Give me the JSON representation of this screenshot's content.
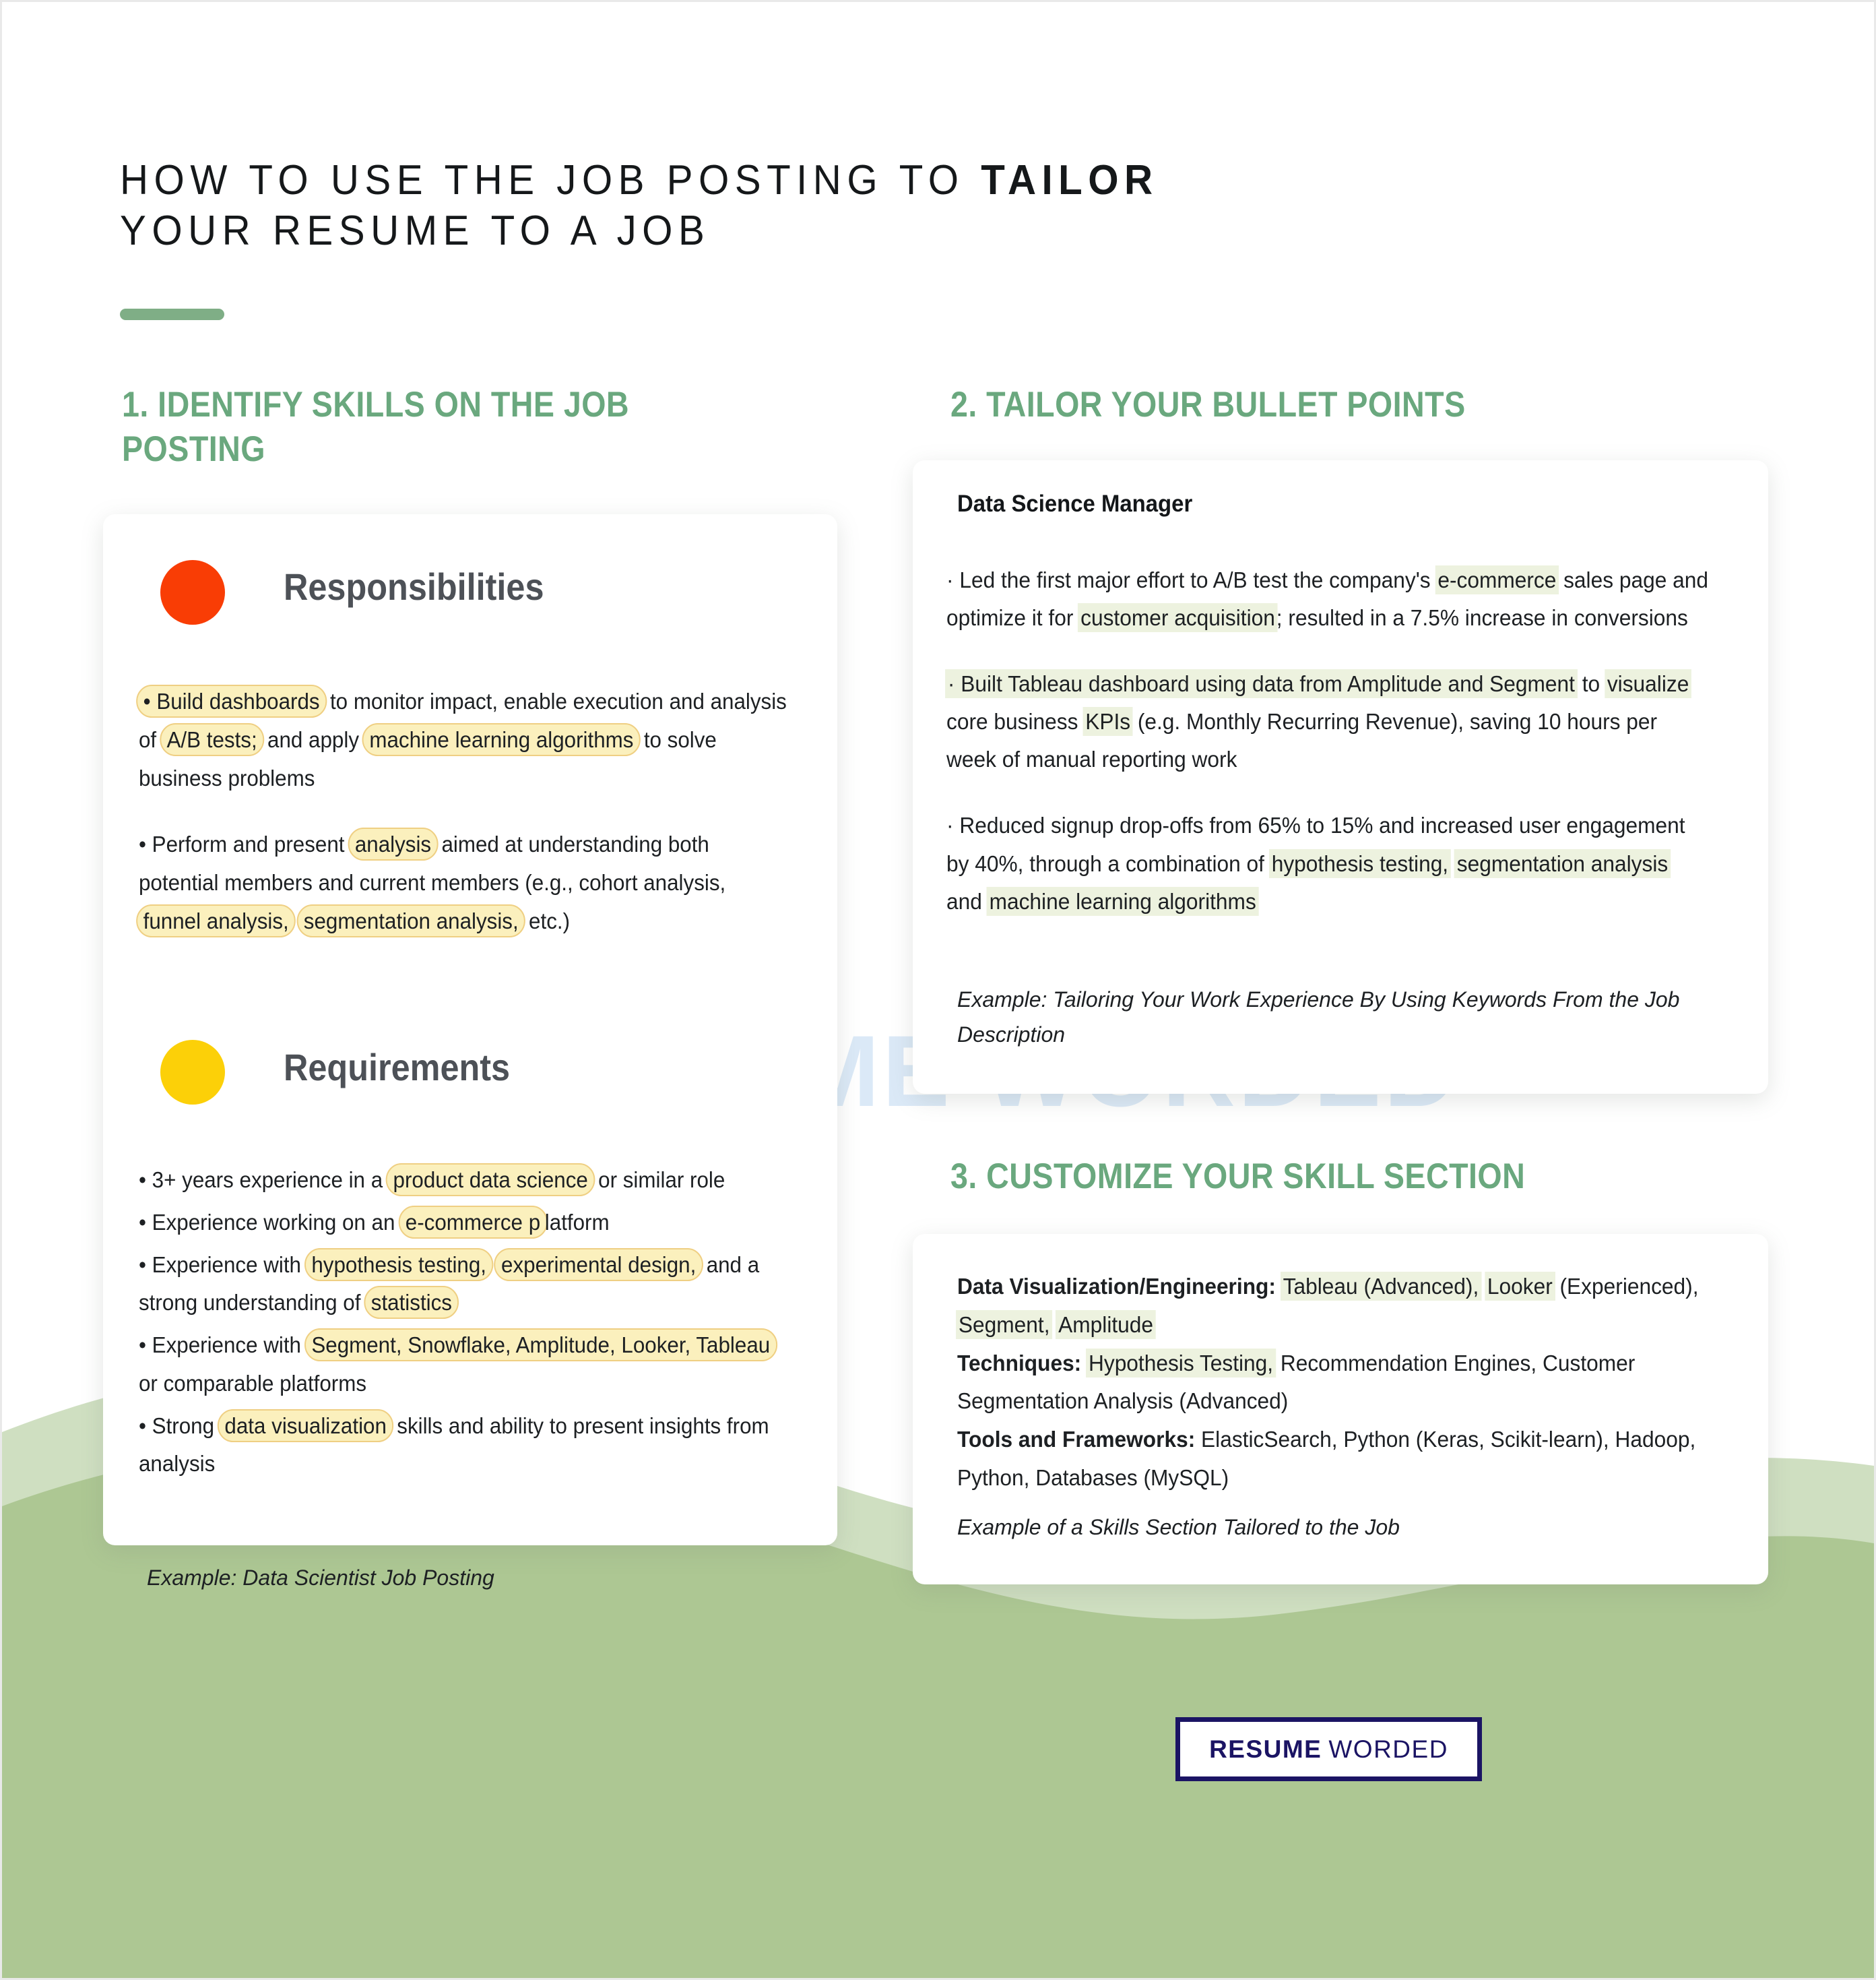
{
  "title": {
    "line1_pre": "HOW TO USE THE JOB POSTING TO ",
    "line1_bold": "TAILOR",
    "line2": "YOUR RESUME TO A JOB"
  },
  "sections": {
    "one": "1. IDENTIFY SKILLS ON THE JOB POSTING",
    "two": "2. TAILOR YOUR BULLET POINTS",
    "three": "3. CUSTOMIZE YOUR SKILL SECTION"
  },
  "left_card": {
    "responsibilities_heading": "Responsibilities",
    "requirements_heading": "Requirements",
    "responsibilities": [
      "• Build dashboards to monitor impact, enable execution and analysis of A/B tests; and apply machine learning algorithms to solve business problems",
      "• Perform and present analysis aimed at understanding both potential members and current members (e.g., cohort analysis, funnel analysis, segmentation analysis, etc.)"
    ],
    "requirements": [
      "• 3+ years experience in a product data science or similar role",
      "• Experience working on an e-commerce platform",
      "• Experience with hypothesis testing, experimental design, and a strong understanding of statistics",
      "• Experience with Segment, Snowflake, Amplitude, Looker, Tableau or comparable platforms",
      "• Strong data visualization skills and ability to present insights from analysis"
    ],
    "highlighted_keywords": [
      "Build dashboards",
      "A/B tests;",
      "machine learning algorithms",
      "analysis",
      "funnel analysis,",
      "segmentation analysis,",
      "product data science",
      "e-commerce p",
      "hypothesis testing,",
      "experimental design,",
      "statistics",
      "Segment, Snowflake, Amplitude, Looker, Tableau",
      "data visualization"
    ],
    "caption": "Example: Data Scientist Job Posting"
  },
  "mid_card": {
    "job_title": "Data Science Manager",
    "bullets": [
      "· Led the first major effort to A/B test the company's e-commerce sales page and optimize it for customer acquisition; resulted in a 7.5% increase in conversions",
      "· Built Tableau dashboard using data from Amplitude and Segment to visualize core business KPIs (e.g. Monthly Recurring Revenue), saving 10 hours per week of manual reporting work",
      "· Reduced signup drop-offs from 65% to 15% and increased user engagement by 40%, through a combination of hypothesis testing, segmentation analysis and machine learning algorithms"
    ],
    "highlighted_keywords": [
      "e-commerce",
      "customer acquisition",
      "Built Tableau dashboard using data from Amplitude and Segment",
      "visualize",
      "KPIs",
      "hypothesis testing,",
      "segmentation analysis",
      "machine learning algorithms"
    ],
    "caption": "Example: Tailoring Your Work Experience By Using Keywords From the Job Description"
  },
  "skills_card": {
    "rows": [
      {
        "label": "Data Visualization/Engineering:",
        "value": "Tableau (Advanced), Looker (Experienced), Segment, Amplitude"
      },
      {
        "label": "Techniques:",
        "value": "Hypothesis Testing, Recommendation Engines, Customer Segmentation Analysis (Advanced)"
      },
      {
        "label": "Tools and Frameworks:",
        "value": "ElasticSearch, Python (Keras, Scikit-learn), Hadoop, Python, Databases (MySQL)"
      }
    ],
    "highlighted_keywords": [
      "Tableau (Advanced),",
      "Looker",
      "Segment,",
      "Amplitude",
      "Hypothesis Testing,"
    ],
    "caption": "Example of a Skills Section Tailored to the Job"
  },
  "watermark": "RESUME WORDED",
  "footer_badge": {
    "bold": "RESUME",
    "regular": "WORDED"
  },
  "colors": {
    "green_accent": "#7fae86",
    "section_heading_green": "#6aa87e",
    "wave_green": "#adc793",
    "wave_green_light": "#cfdfc1",
    "dot_red": "#f93d05",
    "dot_yellow": "#fcd008",
    "highlight_yellow": "#fbf0bd",
    "highlight_yellow_border": "#efcf83",
    "highlight_green": "#edf2df",
    "badge_navy": "#1b1464",
    "watermark_blue": "#dbe9f7"
  }
}
